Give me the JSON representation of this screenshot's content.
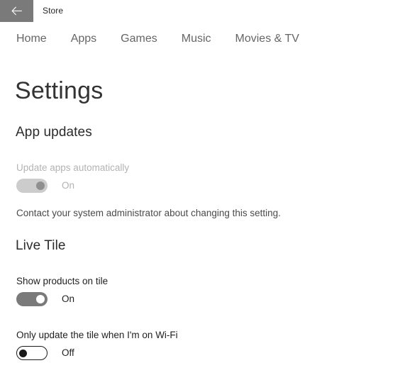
{
  "window": {
    "app_title": "Store",
    "back_icon": "back-arrow-icon",
    "back_button_color": "#7a7a7a"
  },
  "nav": {
    "items": [
      {
        "label": "Home"
      },
      {
        "label": "Apps"
      },
      {
        "label": "Games"
      },
      {
        "label": "Music"
      },
      {
        "label": "Movies & TV"
      }
    ]
  },
  "page": {
    "title": "Settings"
  },
  "sections": [
    {
      "heading": "App updates",
      "setting": {
        "label": "Update apps automatically",
        "state_text": "On",
        "state": "on",
        "disabled": true
      },
      "helper_text": "Contact your system administrator about changing this setting."
    },
    {
      "heading": "Live Tile",
      "settings": [
        {
          "label": "Show products on tile",
          "state_text": "On",
          "state": "on",
          "disabled": false
        },
        {
          "label": "Only update the tile when I'm on Wi-Fi",
          "state_text": "Off",
          "state": "off",
          "disabled": false
        }
      ]
    }
  ],
  "colors": {
    "background": "#ffffff",
    "toggle_on_track": "#7a7a7a",
    "toggle_off_border": "#1a1a1a",
    "toggle_disabled_track": "#cccccc",
    "nav_text": "#666666",
    "disabled_text": "#b3b3b3"
  }
}
